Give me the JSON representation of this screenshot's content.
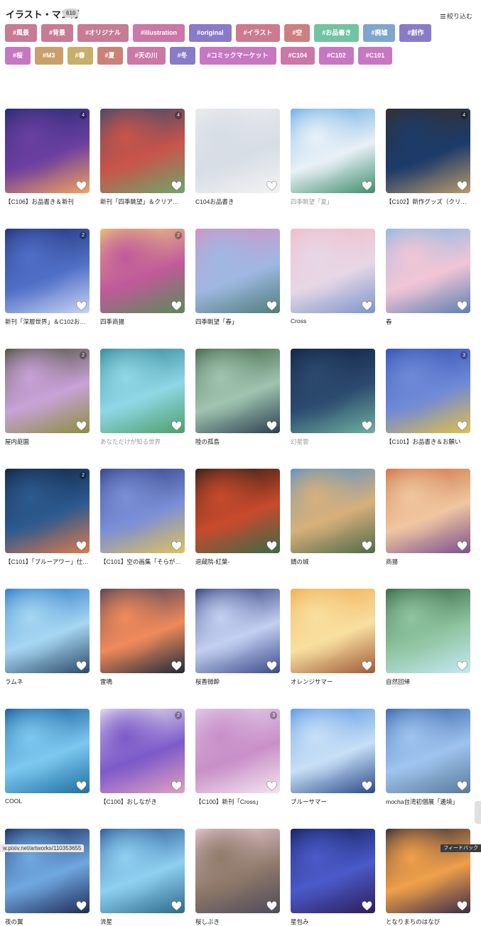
{
  "header": {
    "title": "イラスト・マンガ",
    "count": "610",
    "filter_label": "絞り込む",
    "filter_icon": "filter-lines-icon"
  },
  "tags": [
    {
      "label": "#風景",
      "color": "#c77b95"
    },
    {
      "label": "#背景",
      "color": "#c77b95"
    },
    {
      "label": "#オリジナル",
      "color": "#c77b95"
    },
    {
      "label": "#illustration",
      "color": "#cb77a7"
    },
    {
      "label": "#original",
      "color": "#8a7bc8"
    },
    {
      "label": "#イラスト",
      "color": "#cc7b8f"
    },
    {
      "label": "#空",
      "color": "#cd7f7f"
    },
    {
      "label": "#お品書き",
      "color": "#72c3a2"
    },
    {
      "label": "#廃墟",
      "color": "#7fa6cc"
    },
    {
      "label": "#創作",
      "color": "#8a7bc8"
    },
    {
      "label": "#桜",
      "color": "#c777c1"
    },
    {
      "label": "#M3",
      "color": "#c9a06c"
    },
    {
      "label": "#春",
      "color": "#c9ad6a"
    },
    {
      "label": "#夏",
      "color": "#cc8177"
    },
    {
      "label": "#天の川",
      "color": "#cb77a7"
    },
    {
      "label": "#冬",
      "color": "#8a7bc8"
    },
    {
      "label": "#コミックマーケット",
      "color": "#c777c1"
    },
    {
      "label": "#C104",
      "color": "#cb77a7"
    },
    {
      "label": "#C102",
      "color": "#c777c1"
    },
    {
      "label": "#C101",
      "color": "#c777c1"
    }
  ],
  "artworks": [
    {
      "title": "【C106】お品書き＆新刊",
      "pages": "4",
      "dim": false,
      "bg": [
        "#1a2a6c",
        "#6b3fa0",
        "#f3a35c"
      ]
    },
    {
      "title": "新刊「四季眺望」＆クリアファ…",
      "pages": "4",
      "dim": false,
      "bg": [
        "#2b4a6f",
        "#c9544a",
        "#6fa56c"
      ]
    },
    {
      "title": "C104お品書き",
      "pages": "",
      "dim": false,
      "bg": [
        "#eeeeee",
        "#d7dde6",
        "#f2f2f2"
      ]
    },
    {
      "title": "四季眺望「夏」",
      "pages": "",
      "dim": true,
      "bg": [
        "#5aa6e0",
        "#e9f1f7",
        "#3f8e6e"
      ]
    },
    {
      "title": "【C102】新作グッズ（クリアファ…",
      "pages": "4",
      "dim": false,
      "bg": [
        "#3a2e24",
        "#1c3b6a",
        "#b89a6a"
      ]
    },
    {
      "title": "新刊「深層世界」＆C102お品…",
      "pages": "2",
      "dim": false,
      "bg": [
        "#1e2c6e",
        "#4f6fc7",
        "#c9d4f2"
      ]
    },
    {
      "title": "四季商揚",
      "pages": "2",
      "dim": false,
      "bg": [
        "#f2d27a",
        "#c05a9a",
        "#5a8a5a"
      ]
    },
    {
      "title": "四季眺望「春」",
      "pages": "",
      "dim": false,
      "bg": [
        "#d88ec0",
        "#9fb8e3",
        "#4f7f7a"
      ]
    },
    {
      "title": "Cross",
      "pages": "",
      "dim": false,
      "bg": [
        "#f2b8c4",
        "#e7d7e6",
        "#7c96c9"
      ]
    },
    {
      "title": "春",
      "pages": "",
      "dim": false,
      "bg": [
        "#7fb8e6",
        "#f1c6d6",
        "#5e7fb0"
      ]
    },
    {
      "title": "屋内庭園",
      "pages": "2",
      "dim": false,
      "bg": [
        "#3f4a2c",
        "#c9a2d8",
        "#8a8f3e"
      ]
    },
    {
      "title": "あなただけが知る世界",
      "pages": "",
      "dim": true,
      "bg": [
        "#2c7c8f",
        "#8fd7e6",
        "#4f9f6a"
      ]
    },
    {
      "title": "陸の孤島",
      "pages": "",
      "dim": false,
      "bg": [
        "#3a5a3a",
        "#9fc4b0",
        "#2c4050"
      ]
    },
    {
      "title": "幻星雲",
      "pages": "",
      "dim": true,
      "bg": [
        "#0f1f3f",
        "#2c4a6f",
        "#6fb0a0"
      ]
    },
    {
      "title": "【C101】お品書き＆お願い",
      "pages": "3",
      "dim": false,
      "bg": [
        "#2c4ab0",
        "#6f8ad7",
        "#e0c04a"
      ]
    },
    {
      "title": "【C101】「ブルーアワー」仕掛けク…",
      "pages": "2",
      "dim": false,
      "bg": [
        "#0f1f3a",
        "#2c5a8f",
        "#e07a4a"
      ]
    },
    {
      "title": "【C101】空の画集「そらがたり」",
      "pages": "",
      "dim": false,
      "bg": [
        "#2c3a7c",
        "#7a8fd7",
        "#e0c25a"
      ]
    },
    {
      "title": "退蔵院-紅葉-",
      "pages": "",
      "dim": false,
      "bg": [
        "#1f1a16",
        "#c94a2c",
        "#3a6a4a"
      ]
    },
    {
      "title": "錆の城",
      "pages": "",
      "dim": false,
      "bg": [
        "#4f8fd0",
        "#d7b07a",
        "#4f6a4a"
      ]
    },
    {
      "title": "商揚",
      "pages": "",
      "dim": false,
      "bg": [
        "#c96a3a",
        "#f0c7a0",
        "#7c4f8f"
      ]
    },
    {
      "title": "ラムネ",
      "pages": "",
      "dim": false,
      "bg": [
        "#1f6fc4",
        "#a6d7f2",
        "#2c4a6a"
      ]
    },
    {
      "title": "雷鳴",
      "pages": "",
      "dim": false,
      "bg": [
        "#3a3a5a",
        "#f08a5a",
        "#1f2a3a"
      ]
    },
    {
      "title": "桜香微酔",
      "pages": "",
      "dim": false,
      "bg": [
        "#1f2c6e",
        "#c4d0f2",
        "#3a4a8a"
      ]
    },
    {
      "title": "オレンジサマー",
      "pages": "",
      "dim": false,
      "bg": [
        "#f0a84a",
        "#f8e0a0",
        "#a05a3a"
      ]
    },
    {
      "title": "自然回帰",
      "pages": "",
      "dim": false,
      "bg": [
        "#2c5a3a",
        "#8fc4a0",
        "#c4e8f2"
      ]
    },
    {
      "title": "COOL",
      "pages": "",
      "dim": false,
      "bg": [
        "#0f4f8f",
        "#7cc8f0",
        "#1f6fa0"
      ]
    },
    {
      "title": "【C100】おしながき",
      "pages": "2",
      "dim": false,
      "bg": [
        "#f2f2f2",
        "#7c5ac9",
        "#e0a0c0"
      ]
    },
    {
      "title": "【C100】新刊「Cross」",
      "pages": "3",
      "dim": false,
      "bg": [
        "#e6d6ef",
        "#c98fc8",
        "#f2e4f0"
      ]
    },
    {
      "title": "ブルーサマー",
      "pages": "",
      "dim": false,
      "bg": [
        "#4f8fe0",
        "#c8e0f7",
        "#2c4a8a"
      ]
    },
    {
      "title": "mocha台湾初個展「邊境」",
      "pages": "",
      "dim": false,
      "bg": [
        "#2c5aa0",
        "#9fc4ef",
        "#5a7a9a"
      ]
    },
    {
      "title": "夜の翼",
      "pages": "",
      "dim": false,
      "bg": [
        "#0f1f4f",
        "#6fa8e0",
        "#1f2c5a"
      ]
    },
    {
      "title": "流星",
      "pages": "",
      "dim": false,
      "bg": [
        "#1f4a8f",
        "#8fd0f0",
        "#2c6a8a"
      ]
    },
    {
      "title": "桜しぶき",
      "pages": "",
      "dim": false,
      "bg": [
        "#f2d0e0",
        "#8f7a6a",
        "#4f4a5a"
      ]
    },
    {
      "title": "星包み",
      "pages": "",
      "dim": false,
      "bg": [
        "#0f1a4f",
        "#4a5ac9",
        "#2c1f5a"
      ]
    },
    {
      "title": "となりまちのはなび",
      "pages": "",
      "dim": false,
      "bg": [
        "#1f1f3a",
        "#f0a04a",
        "#3a2c4a"
      ]
    }
  ],
  "statusbar": {
    "url": "w.pixiv.net/artworks/110353655"
  },
  "feedback": {
    "label": "フィードバック"
  }
}
